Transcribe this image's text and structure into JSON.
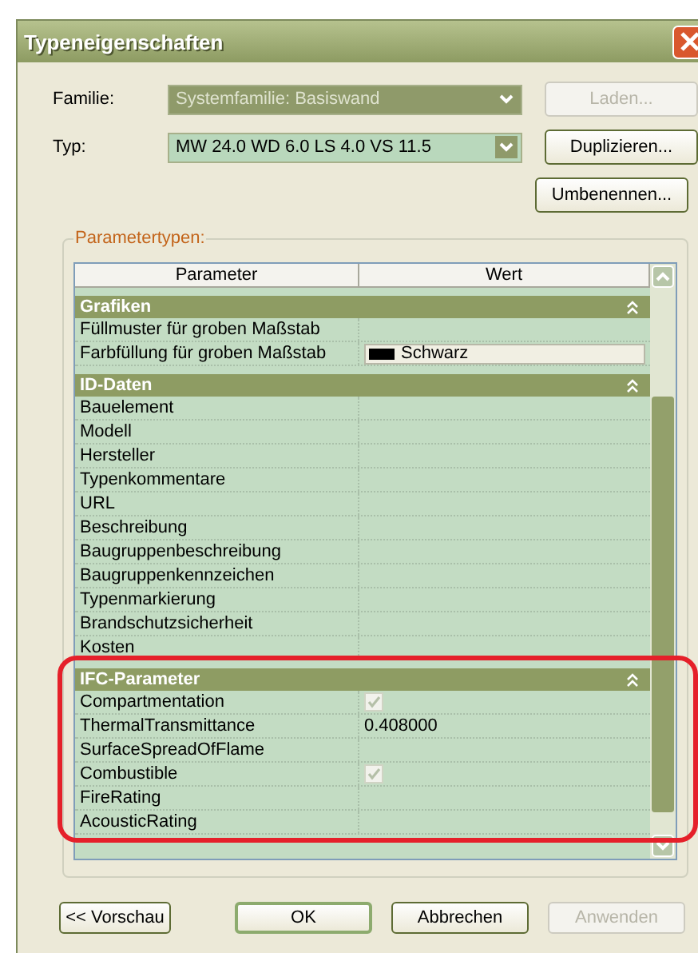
{
  "window": {
    "title": "Typeneigenschaften"
  },
  "fields": [
    {
      "label": "Familie:",
      "value": "Systemfamilie: Basiswand",
      "disabled": true,
      "button": {
        "label": "Laden...",
        "disabled": true
      }
    },
    {
      "label": "Typ:",
      "value": "MW 24.0 WD 6.0 LS 4.0 VS 11.5",
      "disabled": false,
      "button": {
        "label": "Duplizieren...",
        "disabled": false
      }
    }
  ],
  "rename_button": {
    "label": "Umbenennen...",
    "disabled": false
  },
  "group": {
    "label": "Parametertypen:"
  },
  "table": {
    "columns": [
      "Parameter",
      "Wert"
    ],
    "groups": [
      {
        "title": "Grafiken",
        "expanded": true,
        "highlighted": false,
        "rows": [
          {
            "name": "Füllmuster für groben Maßstab",
            "kind": "text"
          },
          {
            "name": "Farbfüllung für groben Maßstab",
            "kind": "color",
            "value": "Schwarz",
            "color": "#000000"
          }
        ]
      },
      {
        "title": "ID-Daten",
        "expanded": true,
        "highlighted": false,
        "rows": [
          {
            "name": "Bauelement",
            "kind": "text"
          },
          {
            "name": "Modell",
            "kind": "text"
          },
          {
            "name": "Hersteller",
            "kind": "text"
          },
          {
            "name": "Typenkommentare",
            "kind": "text"
          },
          {
            "name": "URL",
            "kind": "text"
          },
          {
            "name": "Beschreibung",
            "kind": "text"
          },
          {
            "name": "Baugruppenbeschreibung",
            "kind": "text"
          },
          {
            "name": "Baugruppenkennzeichen",
            "kind": "text"
          },
          {
            "name": "Typenmarkierung",
            "kind": "text"
          },
          {
            "name": "Brandschutzsicherheit",
            "kind": "text"
          },
          {
            "name": "Kosten",
            "kind": "text"
          }
        ]
      },
      {
        "title": "IFC-Parameter",
        "expanded": true,
        "highlighted": true,
        "rows": [
          {
            "name": "Compartmentation",
            "kind": "checkbox",
            "checked": true
          },
          {
            "name": "ThermalTransmittance",
            "kind": "text",
            "value": "0.408000"
          },
          {
            "name": "SurfaceSpreadOfFlame",
            "kind": "text"
          },
          {
            "name": "Combustible",
            "kind": "checkbox",
            "checked": true
          },
          {
            "name": "FireRating",
            "kind": "text"
          },
          {
            "name": "AcousticRating",
            "kind": "text"
          }
        ]
      }
    ]
  },
  "buttons": [
    {
      "label": "<< Vorschau",
      "disabled": false,
      "default": false
    },
    {
      "label": "OK",
      "disabled": false,
      "default": true
    },
    {
      "label": "Abbrechen",
      "disabled": false,
      "default": false
    },
    {
      "label": "Anwenden",
      "disabled": true,
      "default": false
    }
  ]
}
